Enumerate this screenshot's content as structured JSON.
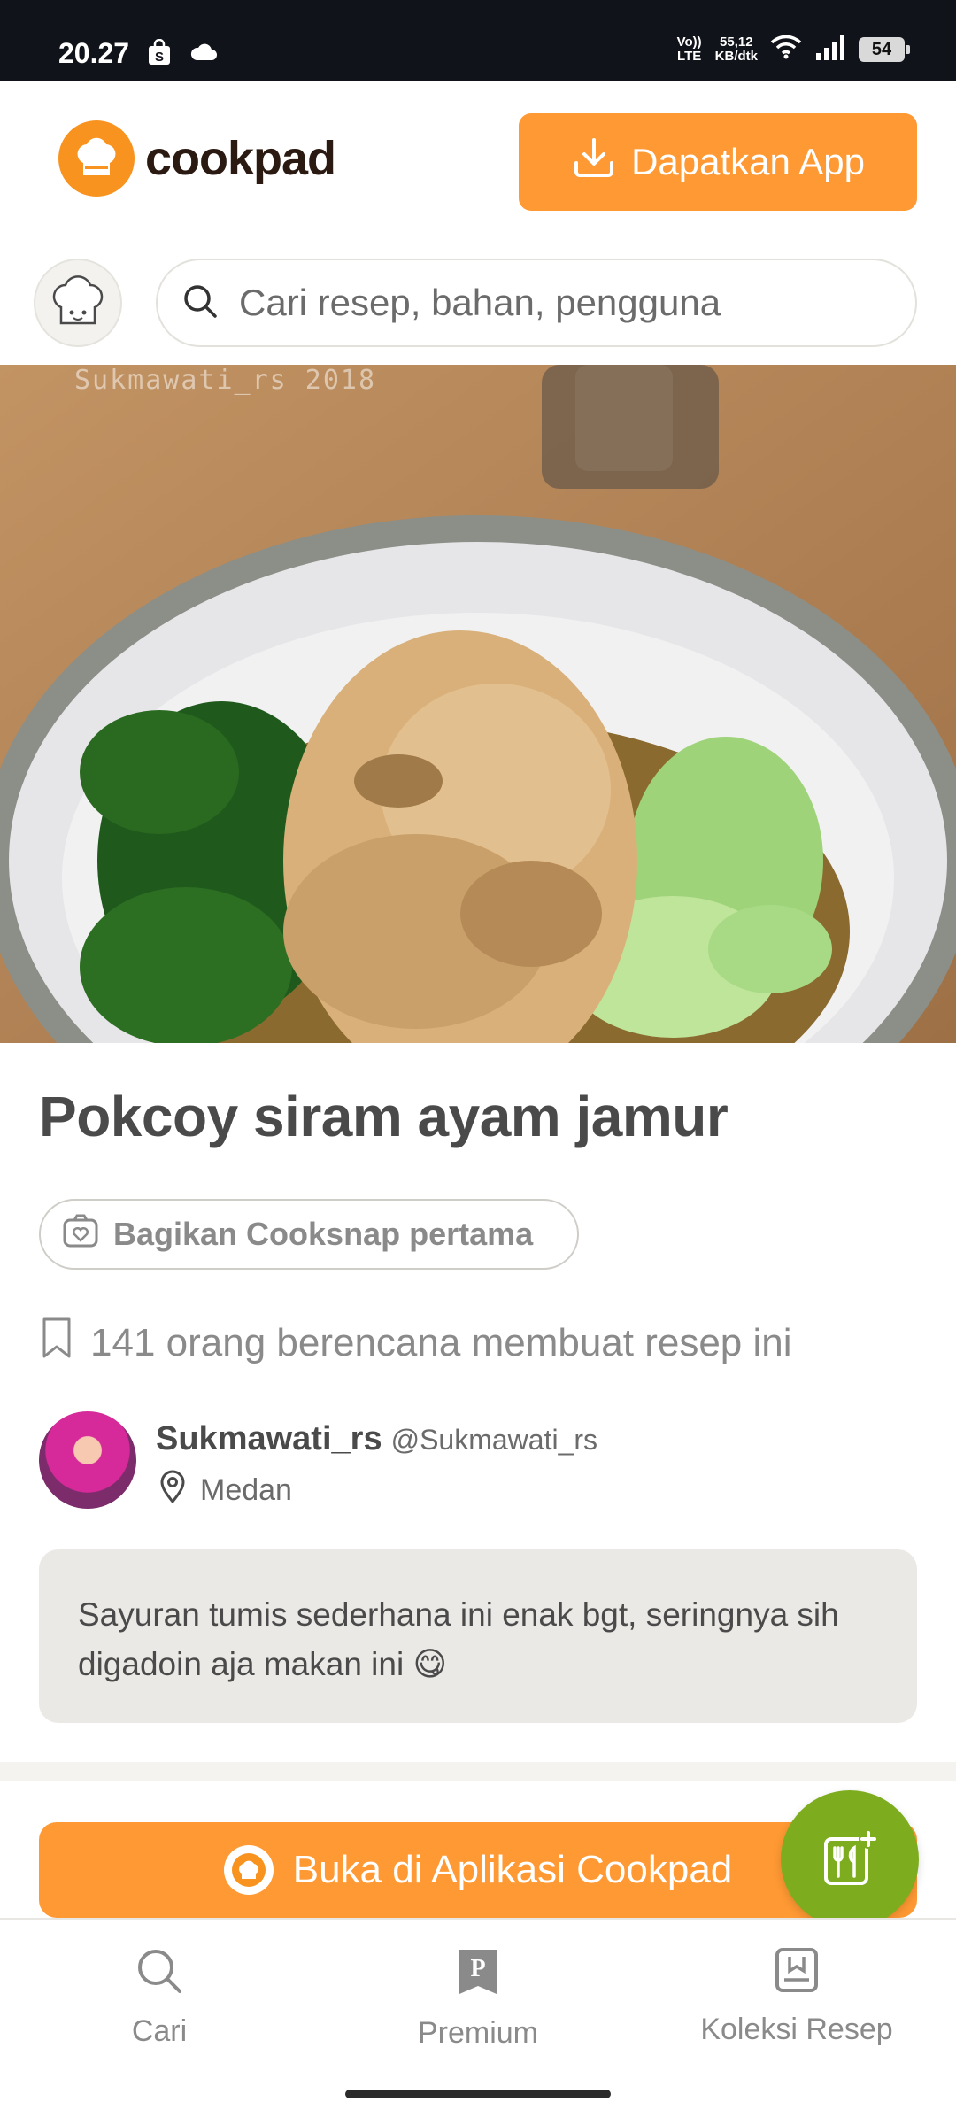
{
  "status_bar": {
    "time": "20.27",
    "volte": "Vo)) LTE",
    "speed_value": "55,12",
    "speed_unit": "KB/dtk",
    "battery": "54"
  },
  "header": {
    "logo_text": "cookpad",
    "get_app_label": "Dapatkan App"
  },
  "search": {
    "placeholder": "Cari resep, bahan, pengguna"
  },
  "hero": {
    "watermark": "Sukmawati_rs 2018"
  },
  "recipe": {
    "title": "Pokcoy siram ayam jamur",
    "cooksnap_label": "Bagikan Cooksnap pertama",
    "plans_text": "141 orang berencana membuat resep ini",
    "author_name": "Sukmawati_rs",
    "author_handle": "@Sukmawati_rs",
    "author_location": "Medan",
    "description": "Sayuran tumis sederhana ini enak bgt, seringnya sih digadoin aja makan ini 😋"
  },
  "cta": {
    "open_app_label": "Buka di Aplikasi Cookpad"
  },
  "bottom_nav": {
    "items": [
      {
        "label": "Cari",
        "icon": "search-icon"
      },
      {
        "label": "Premium",
        "icon": "premium-icon"
      },
      {
        "label": "Koleksi Resep",
        "icon": "collection-icon"
      }
    ]
  },
  "colors": {
    "brand_orange": "#ff9933",
    "fab_green": "#7dad1f",
    "status_bar": "#11131a"
  }
}
